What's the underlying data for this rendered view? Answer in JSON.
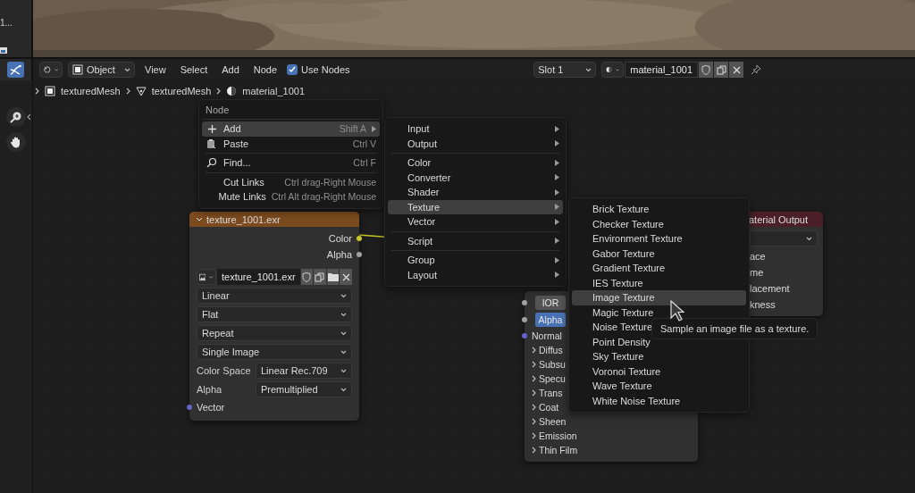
{
  "side_panel": {
    "label": "1..."
  },
  "header": {
    "mode": "Object",
    "menus": [
      "View",
      "Select",
      "Add",
      "Node"
    ],
    "use_nodes": {
      "label": "Use Nodes",
      "checked": true
    },
    "slot": "Slot 1",
    "material": "material_1001"
  },
  "breadcrumb": [
    {
      "kind": "object",
      "label": "texturedMesh"
    },
    {
      "kind": "mesh",
      "label": "texturedMesh"
    },
    {
      "kind": "material",
      "label": "material_1001"
    }
  ],
  "image_node": {
    "title": "texture_1001.exr",
    "expanded": true,
    "outputs": [
      {
        "label": "Color",
        "color": "#c7c729",
        "linked": true
      },
      {
        "label": "Alpha",
        "color": "#a1a1a1",
        "linked": false
      }
    ],
    "image": "texture_1001.exr",
    "dropdowns": [
      "Linear",
      "Flat",
      "Repeat",
      "Single Image"
    ],
    "properties": [
      {
        "label": "Color Space",
        "value": "Linear Rec.709"
      },
      {
        "label": "Alpha",
        "value": "Premultiplied"
      }
    ],
    "inputs": [
      {
        "label": "Vector",
        "color": "#6363c7"
      }
    ]
  },
  "bsdf_node": {
    "fields": [
      {
        "label": "IOR",
        "kind": "number"
      },
      {
        "label": "Alpha",
        "kind": "slider",
        "level": 1
      }
    ],
    "inputs": [
      {
        "label": "Normal",
        "color": "#6363c7"
      }
    ],
    "panels": [
      "Diffus",
      "Subsu",
      "Specu",
      "Trans",
      "Coat",
      "Sheen",
      "Emission",
      "Thin Film"
    ]
  },
  "output_node": {
    "title": "aterial Output",
    "sockets": [
      "ace",
      "me",
      "lacement",
      "kness"
    ]
  },
  "context_menu": {
    "title": "Node",
    "items": [
      {
        "kind": "item",
        "label": "Add",
        "shortcut": "Shift A",
        "submenu": true,
        "selected": true
      },
      {
        "kind": "item",
        "label": "Paste",
        "shortcut": "Ctrl V",
        "submenu": false,
        "selected": false
      },
      {
        "kind": "separator"
      },
      {
        "kind": "item",
        "label": "Find...",
        "shortcut": "Ctrl F",
        "submenu": false,
        "selected": false
      },
      {
        "kind": "separator"
      },
      {
        "kind": "item",
        "label": "Cut Links",
        "shortcut": "Ctrl drag-Right Mouse",
        "submenu": false,
        "selected": false
      },
      {
        "kind": "item",
        "label": "Mute Links",
        "shortcut": "Ctrl Alt drag-Right Mouse",
        "submenu": false,
        "selected": false
      }
    ]
  },
  "add_menu": [
    {
      "kind": "item",
      "label": "Input",
      "selected": false
    },
    {
      "kind": "item",
      "label": "Output",
      "selected": false
    },
    {
      "kind": "separator"
    },
    {
      "kind": "item",
      "label": "Color",
      "selected": false
    },
    {
      "kind": "item",
      "label": "Converter",
      "selected": false
    },
    {
      "kind": "item",
      "label": "Shader",
      "selected": false
    },
    {
      "kind": "item",
      "label": "Texture",
      "selected": true
    },
    {
      "kind": "item",
      "label": "Vector",
      "selected": false
    },
    {
      "kind": "separator"
    },
    {
      "kind": "item",
      "label": "Script",
      "selected": false
    },
    {
      "kind": "separator"
    },
    {
      "kind": "item",
      "label": "Group",
      "selected": false
    },
    {
      "kind": "item",
      "label": "Layout",
      "selected": false
    }
  ],
  "texture_menu": [
    {
      "label": "Brick Texture",
      "selected": false
    },
    {
      "label": "Checker Texture",
      "selected": false
    },
    {
      "label": "Environment Texture",
      "selected": false
    },
    {
      "label": "Gabor Texture",
      "selected": false
    },
    {
      "label": "Gradient Texture",
      "selected": false
    },
    {
      "label": "IES Texture",
      "selected": false
    },
    {
      "label": "Image Texture",
      "selected": true
    },
    {
      "label": "Magic Texture",
      "selected": false
    },
    {
      "label": "Noise Texture",
      "selected": false
    },
    {
      "label": "Point Density",
      "selected": false
    },
    {
      "label": "Sky Texture",
      "selected": false
    },
    {
      "label": "Voronoi Texture",
      "selected": false
    },
    {
      "label": "Wave Texture",
      "selected": false
    },
    {
      "label": "White Noise Texture",
      "selected": false
    }
  ],
  "tooltip": "Sample an image file as a texture."
}
